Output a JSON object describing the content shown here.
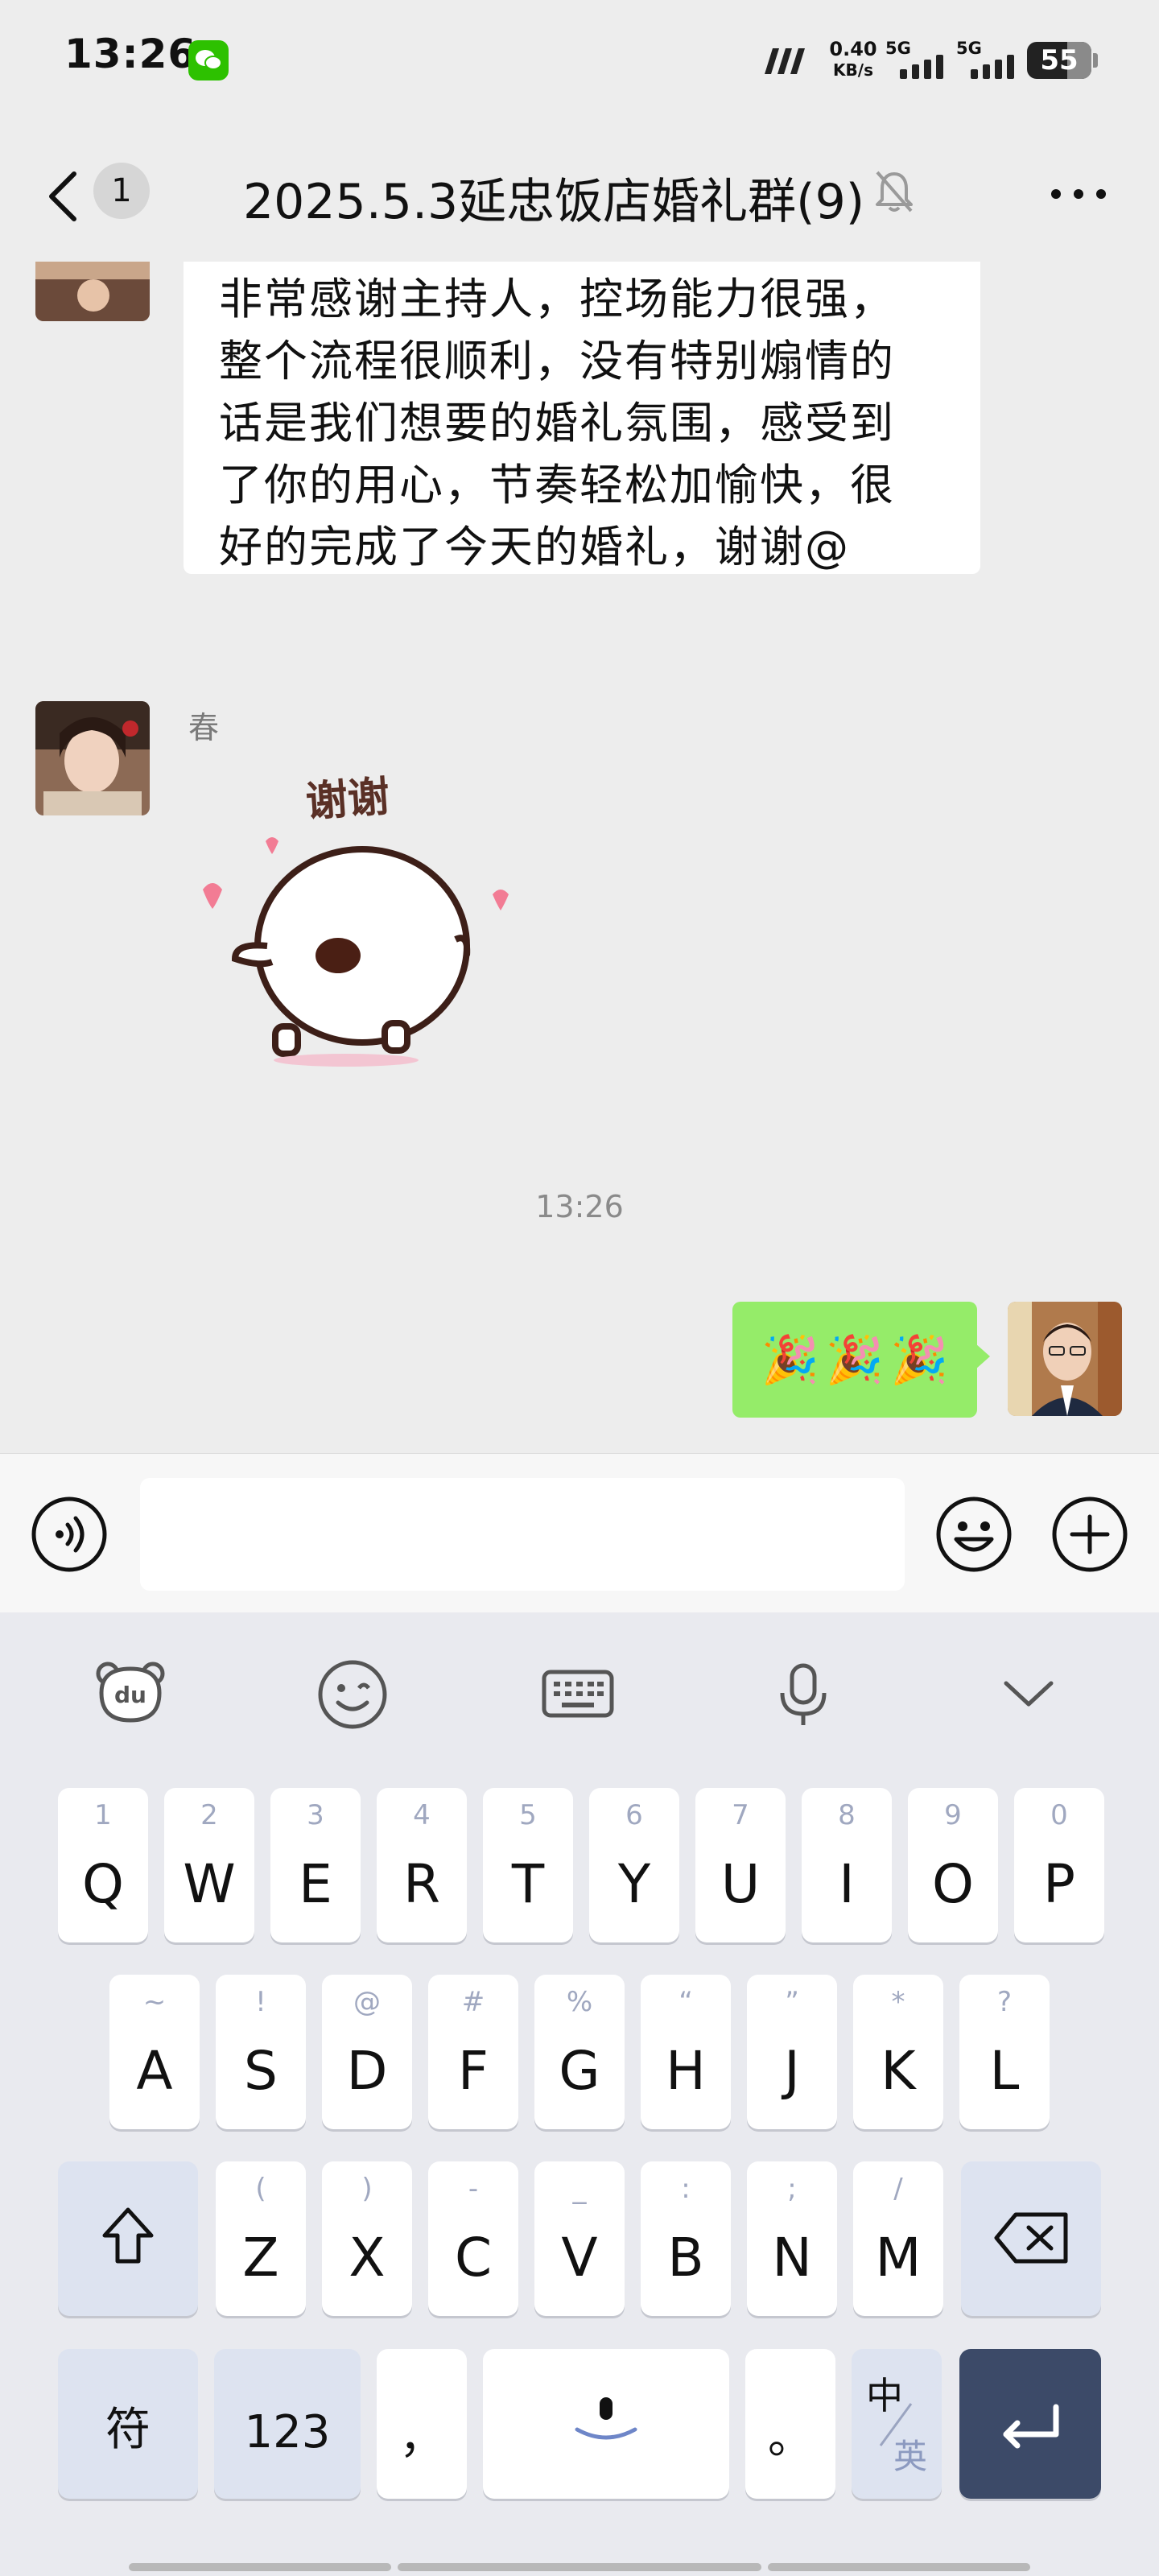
{
  "status_bar": {
    "time": "13:26",
    "net_speed_value": "0.40",
    "net_speed_unit": "KB/s",
    "sim1": "5G",
    "sim2": "5G",
    "battery": "55"
  },
  "header": {
    "unread_count": "1",
    "title": "2025.5.3延忠饭店婚礼群(9)"
  },
  "messages": [
    {
      "side": "left",
      "lines": [
        "非常感谢主持人，控场能力很强，",
        "整个流程很顺利，没有特别煽情的",
        "话是我们想要的婚礼氛围，感受到",
        "了你的用心，节奏轻松加愉快，很",
        "好的完成了今天的婚礼，谢谢@"
      ]
    },
    {
      "side": "left",
      "sender": "春",
      "sticker_text": "谢谢"
    },
    {
      "type": "time",
      "text": "13:26"
    },
    {
      "side": "right",
      "emoji": [
        "🎉",
        "🎉",
        "🎉"
      ]
    }
  ],
  "input": {
    "placeholder": ""
  },
  "keyboard": {
    "row1": [
      {
        "hint": "1",
        "key": "Q"
      },
      {
        "hint": "2",
        "key": "W"
      },
      {
        "hint": "3",
        "key": "E"
      },
      {
        "hint": "4",
        "key": "R"
      },
      {
        "hint": "5",
        "key": "T"
      },
      {
        "hint": "6",
        "key": "Y"
      },
      {
        "hint": "7",
        "key": "U"
      },
      {
        "hint": "8",
        "key": "I"
      },
      {
        "hint": "9",
        "key": "O"
      },
      {
        "hint": "0",
        "key": "P"
      }
    ],
    "row2": [
      {
        "hint": "~",
        "key": "A"
      },
      {
        "hint": "!",
        "key": "S"
      },
      {
        "hint": "@",
        "key": "D"
      },
      {
        "hint": "#",
        "key": "F"
      },
      {
        "hint": "%",
        "key": "G"
      },
      {
        "hint": "“",
        "key": "H"
      },
      {
        "hint": "”",
        "key": "J"
      },
      {
        "hint": "*",
        "key": "K"
      },
      {
        "hint": "?",
        "key": "L"
      }
    ],
    "row3": [
      {
        "hint": "(",
        "key": "Z"
      },
      {
        "hint": ")",
        "key": "X"
      },
      {
        "hint": "-",
        "key": "C"
      },
      {
        "hint": "_",
        "key": "V"
      },
      {
        "hint": ":",
        "key": "B"
      },
      {
        "hint": ";",
        "key": "N"
      },
      {
        "hint": "/",
        "key": "M"
      }
    ],
    "symbols_label": "符",
    "numbers_label": "123",
    "comma_label": "，",
    "period_label": "。",
    "lang_top": "中",
    "lang_bottom": "英"
  }
}
